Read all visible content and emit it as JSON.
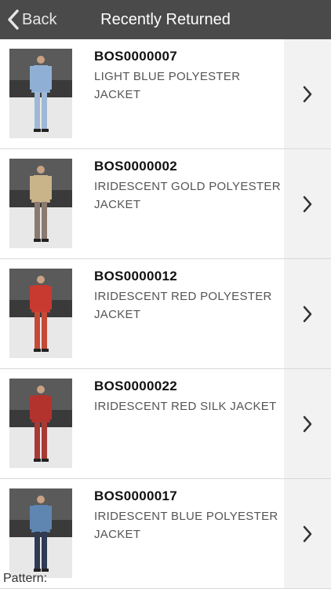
{
  "nav": {
    "back_label": "Back",
    "title": "Recently Returned"
  },
  "items": [
    {
      "code": "BOS0000007",
      "description": "LIGHT BLUE POLYESTER JACKET",
      "jacket_color": "#8fb0d4",
      "pants_color": "#9fb8d6"
    },
    {
      "code": "BOS0000002",
      "description": "IRIDESCENT GOLD POLYESTER JACKET",
      "jacket_color": "#c9b48a",
      "pants_color": "#8a7a70"
    },
    {
      "code": "BOS0000012",
      "description": "IRIDESCENT RED POLYESTER JACKET",
      "jacket_color": "#c8392f",
      "pants_color": "#c44a35"
    },
    {
      "code": "BOS0000022",
      "description": "IRIDESCENT RED SILK JACKET",
      "jacket_color": "#b2332e",
      "pants_color": "#a83a36"
    },
    {
      "code": "BOS0000017",
      "description": "IRIDESCENT BLUE POLYESTER JACKET",
      "jacket_color": "#5f86b0",
      "pants_color": "#2f3a55"
    }
  ],
  "footer": {
    "text": "Pattern:"
  },
  "colors": {
    "navbar": "#4a4a4a",
    "chevron": "#333333"
  }
}
